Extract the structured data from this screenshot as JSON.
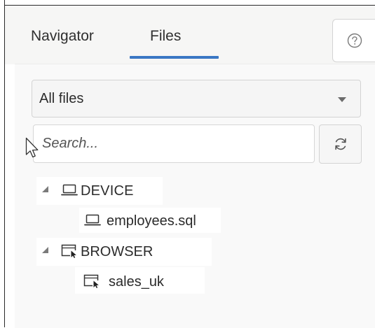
{
  "tabs": [
    {
      "label": "Navigator",
      "active": false
    },
    {
      "label": "Files",
      "active": true
    }
  ],
  "help_icon": "question-circle-icon",
  "file_filter": {
    "selected": "All files",
    "icon": "caret-down-icon"
  },
  "search": {
    "placeholder": "Search...",
    "value": ""
  },
  "refresh_icon": "refresh-icon",
  "tree": [
    {
      "label": "DEVICE",
      "icon": "laptop-icon",
      "expanded": true,
      "children": [
        {
          "label": "employees.sql",
          "icon": "laptop-icon"
        }
      ]
    },
    {
      "label": "BROWSER",
      "icon": "browser-cursor-icon",
      "expanded": true,
      "children": [
        {
          "label": "sales_uk",
          "icon": "browser-cursor-icon"
        }
      ]
    }
  ],
  "colors": {
    "accent": "#3a77c4",
    "panel_bg": "#f9f9f9"
  }
}
